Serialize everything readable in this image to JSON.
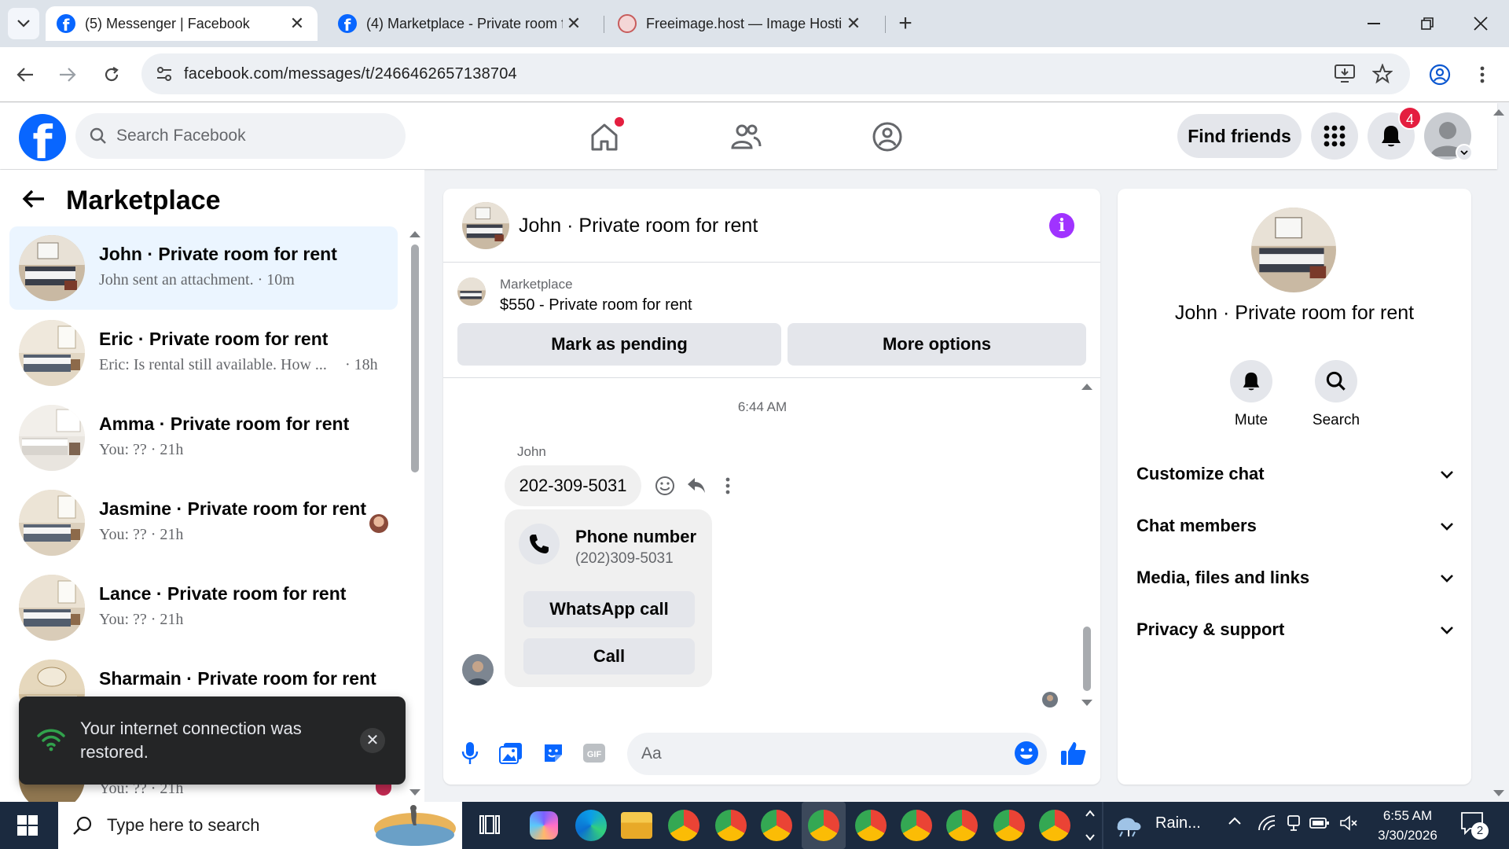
{
  "browser": {
    "tabs": [
      {
        "title": "(5) Messenger | Facebook",
        "active": true
      },
      {
        "title": "(4) Marketplace - Private room f",
        "active": false
      },
      {
        "title": "Freeimage.host — Image Hostir",
        "active": false
      }
    ],
    "url": "facebook.com/messages/t/2466462657138704",
    "new_tab": "+",
    "tab_close": "✕"
  },
  "header": {
    "logo": "f",
    "search_placeholder": "Search Facebook",
    "find_friends": "Find friends",
    "notification_count": "4"
  },
  "sidebar": {
    "title": "Marketplace",
    "conversations": [
      {
        "name": "John · Private room for rent",
        "snippet": "John sent an attachment. · 10m",
        "time": "",
        "selected": true
      },
      {
        "name": "Eric · Private room for rent",
        "snippet": "Eric: Is rental still available. How ...",
        "time": "· 18h",
        "selected": false
      },
      {
        "name": "Amma · Private room for rent",
        "snippet": "You: ?? · 21h",
        "time": "",
        "selected": false
      },
      {
        "name": "Jasmine · Private room for rent",
        "snippet": "You: ?? · 21h",
        "time": "",
        "selected": false
      },
      {
        "name": "Lance · Private room for rent",
        "snippet": "You: ?? · 21h",
        "time": "",
        "selected": false
      },
      {
        "name": "Sharmain · Private room for rent",
        "snippet": "",
        "time": "",
        "selected": false
      },
      {
        "name": "",
        "snippet": "You: ?? · 21h",
        "time": "",
        "selected": false
      }
    ]
  },
  "toast": {
    "message": "Your internet connection was restored.",
    "close": "✕"
  },
  "chat": {
    "title": "John · Private room for rent",
    "info_icon": "i",
    "marketplace_label": "Marketplace",
    "listing": "$550 - Private room for rent",
    "mark_pending": "Mark as pending",
    "more_options": "More options",
    "timestamp": "6:44 AM",
    "sender": "John",
    "message": "202-309-5031",
    "card": {
      "title": "Phone number",
      "value": "(202)309-5031",
      "whatsapp": "WhatsApp call",
      "call": "Call"
    },
    "input_placeholder": "Aa"
  },
  "info_panel": {
    "name": "John · Private room for rent",
    "mute": "Mute",
    "search": "Search",
    "sections": [
      "Customize chat",
      "Chat members",
      "Media, files and links",
      "Privacy & support"
    ]
  },
  "taskbar": {
    "search_placeholder": "Type here to search",
    "weather": "Rain...",
    "time": "6:55 AM",
    "date": "3/30/2026",
    "notif_count": "2"
  },
  "colors": {
    "fb_blue": "#0866ff",
    "selected_bg": "#ebf5ff",
    "info_purple": "#a033ff",
    "badge_red": "#e41e3f"
  }
}
